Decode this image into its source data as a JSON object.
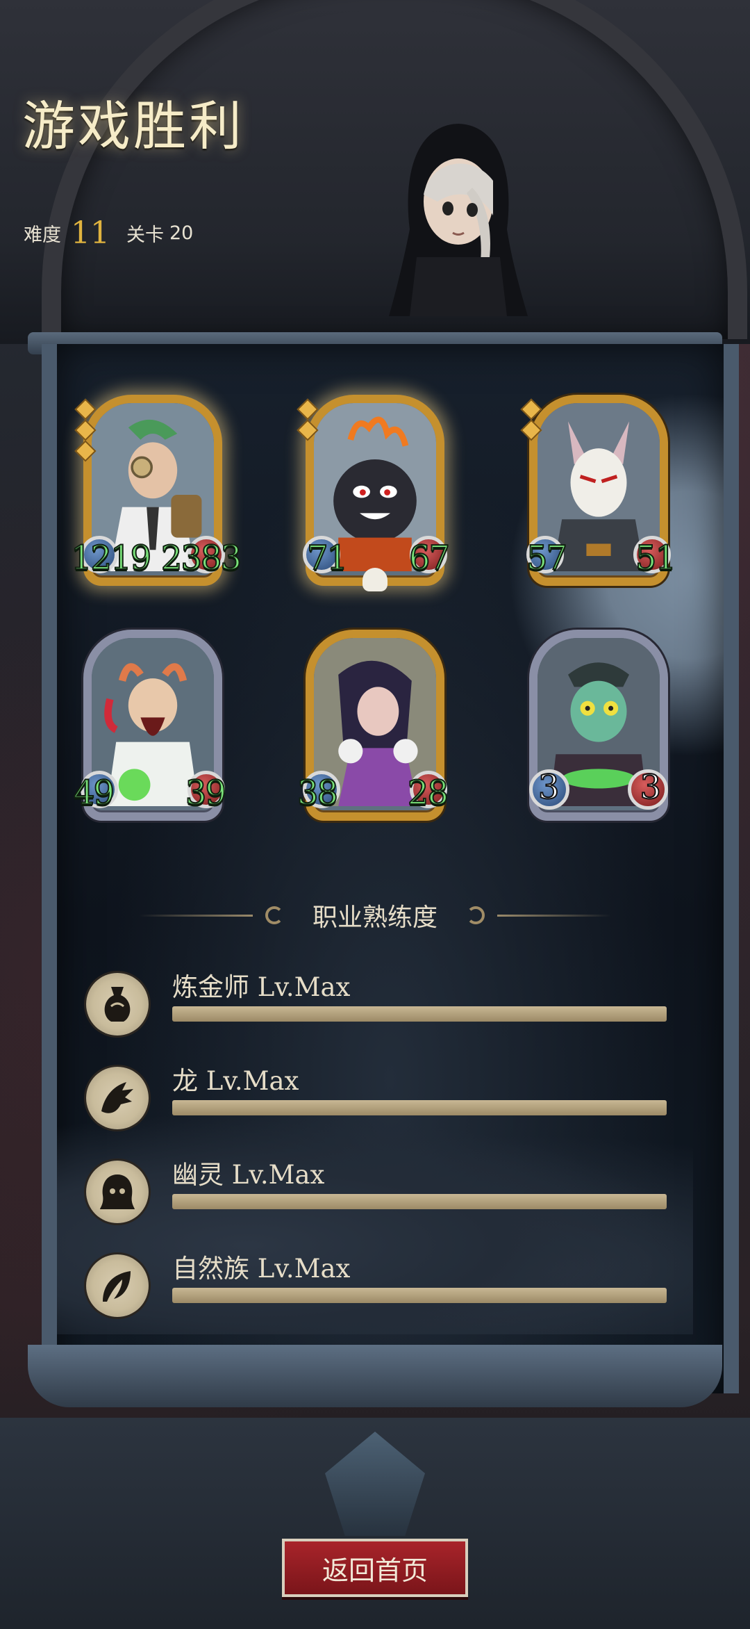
{
  "header": {
    "title": "游戏胜利",
    "difficulty_label": "难度",
    "difficulty_value": "11",
    "stage_label": "关卡",
    "stage_value": "20"
  },
  "cards": [
    {
      "name": "alchemist-card",
      "attack": "1219",
      "health": "2383",
      "frame": "gold",
      "stars": 3
    },
    {
      "name": "bomb-card",
      "attack": "71",
      "health": "67",
      "frame": "gold",
      "stars": 2
    },
    {
      "name": "rat-mask-card",
      "attack": "57",
      "health": "51",
      "frame": "gold",
      "stars": 2
    },
    {
      "name": "mad-scientist-card",
      "attack": "49",
      "health": "39",
      "frame": "silver",
      "stars": 0
    },
    {
      "name": "witch-card",
      "attack": "38",
      "health": "28",
      "frame": "gold",
      "stars": 0
    },
    {
      "name": "zombie-card",
      "attack": "3",
      "health": "3",
      "frame": "silver",
      "stars": 0
    }
  ],
  "mastery": {
    "heading": "职业熟练度",
    "items": [
      {
        "label": "炼金师 Lv.Max",
        "icon": "alchemist-class-icon",
        "progress": 1.0
      },
      {
        "label": "龙 Lv.Max",
        "icon": "dragon-class-icon",
        "progress": 1.0
      },
      {
        "label": "幽灵 Lv.Max",
        "icon": "ghost-class-icon",
        "progress": 1.0
      },
      {
        "label": "自然族 Lv.Max",
        "icon": "nature-class-icon",
        "progress": 1.0
      }
    ]
  },
  "buttons": {
    "home": "返回首页"
  },
  "colors": {
    "gold_frame": "#c5902e",
    "silver_frame": "#8a8fa6",
    "stat_green": "#7ae27a",
    "button_red": "#a8242a"
  }
}
